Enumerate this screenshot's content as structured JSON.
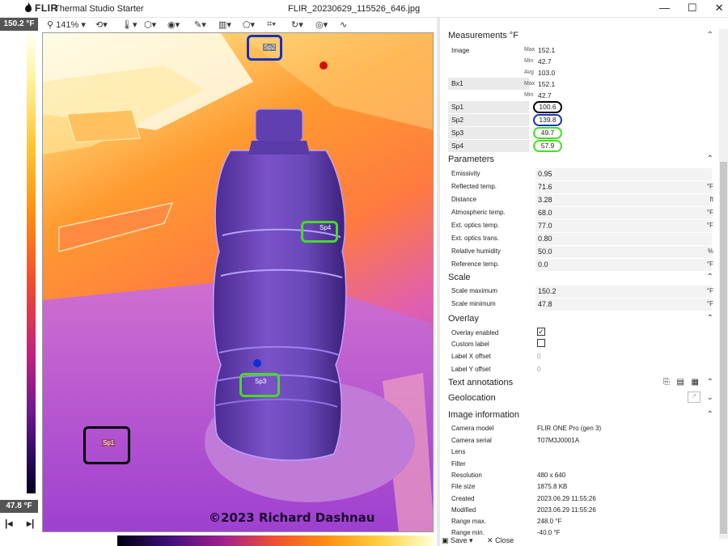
{
  "titlebar": {
    "brand": "FLIR",
    "app_name": "Thermal Studio Starter",
    "filename": "FLIR_20230629_115526_646.jpg"
  },
  "toolbar": {
    "zoom": "141%"
  },
  "scale": {
    "max_label": "150.2 °F",
    "min_label": "47.8 °F"
  },
  "image": {
    "copyright": "©2023 Richard Dashnau",
    "spots": [
      {
        "label": "Sp1",
        "color": "#000000"
      },
      {
        "label": "Sp2",
        "color": "#1a2fc0"
      },
      {
        "label": "Sp3",
        "color": "#44dd22"
      },
      {
        "label": "Sp4",
        "color": "#44dd22"
      }
    ]
  },
  "measurements": {
    "title": "Measurements °F",
    "image_label": "Image",
    "image_max_key": "Max",
    "image_max": "152.1",
    "image_min_key": "Min",
    "image_min": "42.7",
    "image_avg_key": "Avg",
    "image_avg": "103.0",
    "bx1_label": "Bx1",
    "bx1_max_key": "Max",
    "bx1_max": "152.1",
    "bx1_min_key": "Min",
    "bx1_min": "42.7",
    "sp1_label": "Sp1",
    "sp1_val": "100.6",
    "sp2_label": "Sp2",
    "sp2_val": "139.8",
    "sp3_label": "Sp3",
    "sp3_val": "49.7",
    "sp4_label": "Sp4",
    "sp4_val": "57.9"
  },
  "parameters": {
    "title": "Parameters",
    "rows": [
      {
        "label": "Emissivity",
        "value": "0.95",
        "unit": ""
      },
      {
        "label": "Reflected temp.",
        "value": "71.6",
        "unit": "°F"
      },
      {
        "label": "Distance",
        "value": "3.28",
        "unit": "ft"
      },
      {
        "label": "Atmospheric temp.",
        "value": "68.0",
        "unit": "°F"
      },
      {
        "label": "Ext. optics temp.",
        "value": "77.0",
        "unit": "°F"
      },
      {
        "label": "Ext. optics trans.",
        "value": "0.80",
        "unit": ""
      },
      {
        "label": "Relative humidity",
        "value": "50.0",
        "unit": "%"
      },
      {
        "label": "Reference temp.",
        "value": "0.0",
        "unit": "°F"
      }
    ]
  },
  "scale_section": {
    "title": "Scale",
    "rows": [
      {
        "label": "Scale maximum",
        "value": "150.2",
        "unit": "°F"
      },
      {
        "label": "Scale minimum",
        "value": "47.8",
        "unit": "°F"
      }
    ]
  },
  "overlay": {
    "title": "Overlay",
    "overlay_enabled_label": "Overlay enabled",
    "overlay_enabled": true,
    "custom_label_label": "Custom label",
    "custom_label": false,
    "label_x_label": "Label X offset",
    "label_x": "0",
    "label_y_label": "Label Y offset",
    "label_y": "0"
  },
  "text_annotations": {
    "title": "Text annotations"
  },
  "geolocation": {
    "title": "Geolocation"
  },
  "image_info": {
    "title": "Image information",
    "rows": [
      {
        "label": "Camera model",
        "value": "FLIR ONE Pro (gen 3)"
      },
      {
        "label": "Camera serial",
        "value": "T07M3J0001A"
      },
      {
        "label": "Lens",
        "value": ""
      },
      {
        "label": "Filter",
        "value": ""
      },
      {
        "label": "Resolution",
        "value": "480 x 640"
      },
      {
        "label": "File size",
        "value": "1875.8 KB"
      },
      {
        "label": "Created",
        "value": "2023.06.29 11:55:26"
      },
      {
        "label": "Modified",
        "value": "2023.06.29 11:55:26"
      },
      {
        "label": "Range max.",
        "value": "248.0 °F"
      },
      {
        "label": "Range min.",
        "value": "-40.0 °F"
      }
    ]
  },
  "footer": {
    "save": "Save",
    "close": "Close"
  }
}
